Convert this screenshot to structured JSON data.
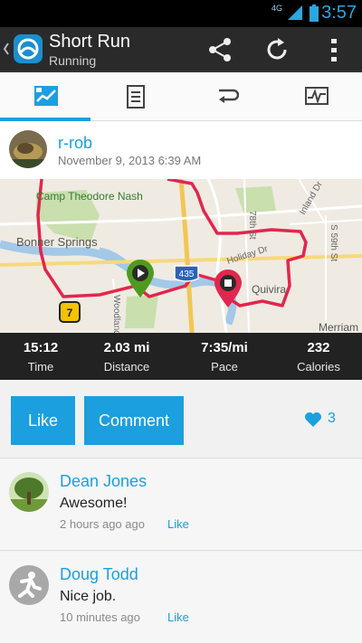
{
  "status_bar": {
    "network": "4G",
    "time": "3:57"
  },
  "action_bar": {
    "title": "Short Run",
    "subtitle": "Running",
    "icons": [
      "back-chevron-icon",
      "app-icon",
      "share-icon",
      "refresh-icon",
      "overflow-menu-icon"
    ]
  },
  "tabs": [
    {
      "name": "map-tab",
      "icon": "map-icon",
      "selected": true
    },
    {
      "name": "details-tab",
      "icon": "document-icon",
      "selected": false
    },
    {
      "name": "laps-tab",
      "icon": "laps-icon",
      "selected": false
    },
    {
      "name": "charts-tab",
      "icon": "chart-icon",
      "selected": false
    }
  ],
  "activity": {
    "owner": "r-rob",
    "date": "November 9, 2013 6:39 AM",
    "map": {
      "labels": [
        "Camp Theodore Nash",
        "Bonner Springs",
        "78th St",
        "Inland Dr",
        "S 59th St",
        "Holiday Dr",
        "Quivira",
        "Merriam",
        "Woodland"
      ],
      "shields": [
        "435",
        "7"
      ]
    },
    "stats": [
      {
        "value": "15:12",
        "label": "Time"
      },
      {
        "value": "2.03 mi",
        "label": "Distance"
      },
      {
        "value": "7:35/mi",
        "label": "Pace"
      },
      {
        "value": "232",
        "label": "Calories"
      }
    ]
  },
  "actions": {
    "like_label": "Like",
    "comment_label": "Comment",
    "like_count": "3"
  },
  "comments": [
    {
      "name": "Dean Jones",
      "text": "Awesome!",
      "time": "2 hours ago ago",
      "like_label": "Like"
    },
    {
      "name": "Doug Todd",
      "text": "Nice job.",
      "time": "10 minutes ago",
      "like_label": "Like"
    }
  ],
  "colors": {
    "accent": "#1c9fdf",
    "route": "#e2264d",
    "statusbar": "#000000",
    "actionbar": "#2a2a2a"
  }
}
